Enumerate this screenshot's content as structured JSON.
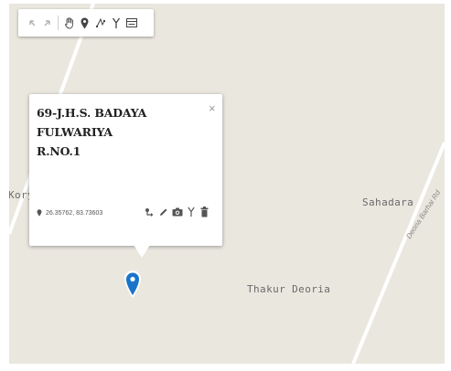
{
  "toolbar": {
    "tools": [
      {
        "id": "undo",
        "icon": "undo-icon"
      },
      {
        "id": "redo",
        "icon": "redo-icon"
      },
      {
        "id": "pan",
        "icon": "hand-icon"
      },
      {
        "id": "marker",
        "icon": "map-pin-icon"
      },
      {
        "id": "draw-line",
        "icon": "draw-line-icon"
      },
      {
        "id": "fork",
        "icon": "fork-icon"
      },
      {
        "id": "layers",
        "icon": "layers-icon"
      }
    ]
  },
  "map": {
    "places": {
      "kory": "Kory",
      "sahadara": "Sahadara",
      "thakur_deoria": "Thakur Deoria"
    },
    "road_label": "Deoria Barhai Rd",
    "colors": {
      "land": "#eae7df",
      "road": "#ffffff",
      "marker": "#1a73c9"
    }
  },
  "popup": {
    "title_line1": "69-J.H.S. BADAYA FULWARIYA",
    "title_line2": "R.NO.1",
    "close_label": "×",
    "coords": "26.35762, 83.73603",
    "actions": [
      {
        "id": "route",
        "icon": "route-icon"
      },
      {
        "id": "edit",
        "icon": "pencil-icon"
      },
      {
        "id": "photo",
        "icon": "camera-icon"
      },
      {
        "id": "fork",
        "icon": "fork-icon"
      },
      {
        "id": "delete",
        "icon": "trash-icon"
      }
    ]
  },
  "marker": {
    "icon": "map-pin-icon"
  }
}
